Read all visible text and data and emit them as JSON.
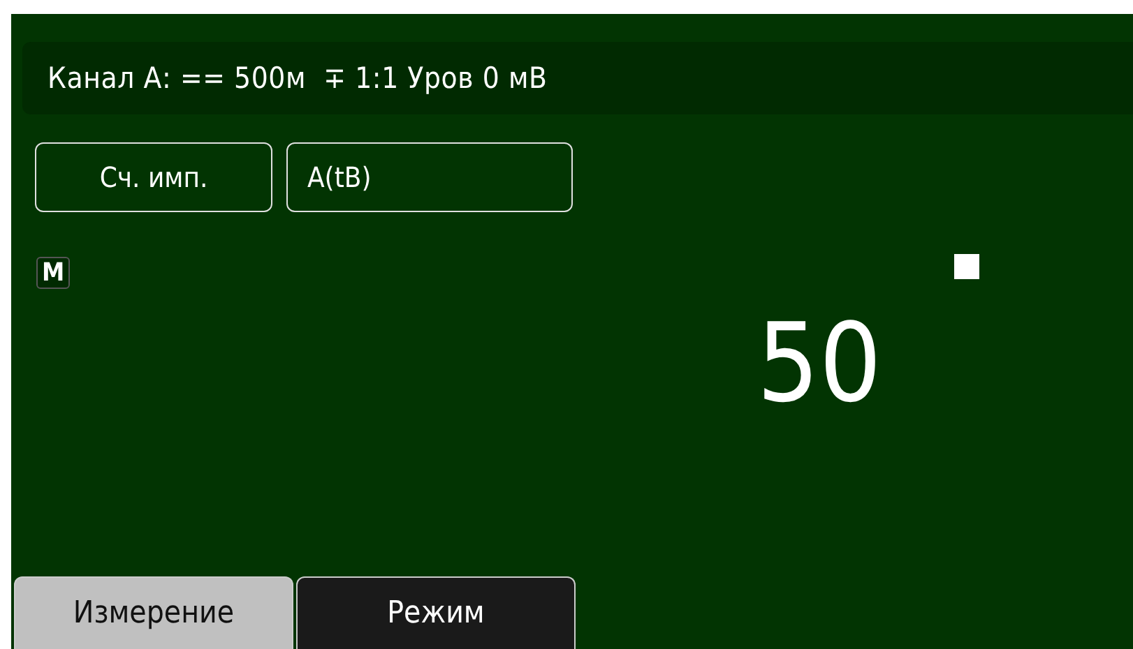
{
  "status_bar": {
    "text": "Канал А: == 500м  ∓ 1:1 Уров 0 мВ"
  },
  "buttons": [
    "Сч. имп.",
    "А(tВ)"
  ],
  "mode_badge": "М",
  "reading": "50",
  "tabs": [
    {
      "label": "Измерение",
      "selected": true
    },
    {
      "label": "Режим",
      "selected": false
    }
  ]
}
